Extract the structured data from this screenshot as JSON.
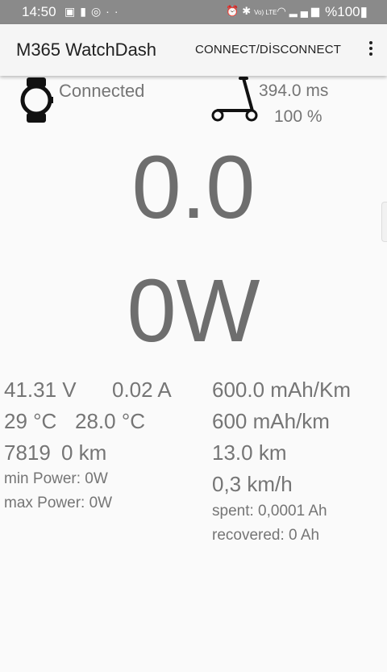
{
  "status_bar": {
    "time": "14:50",
    "battery": "%100",
    "left_icons": [
      "gallery-icon",
      "watch-app-icon",
      "whatsapp-icon",
      "more-dots-icon"
    ],
    "right_icons": [
      "alarm-icon",
      "bluetooth-icon",
      "volte-icon",
      "wifi-icon",
      "signal-icon",
      "battery-icon"
    ],
    "volte_label": "Vo) LTE"
  },
  "app_bar": {
    "title": "M365 WatchDash",
    "connect_label": "CONNECT/DİSCONNECT"
  },
  "watch": {
    "status": "Connected"
  },
  "scooter": {
    "latency": "394.0 ms",
    "battery": "100 %"
  },
  "dashboard": {
    "speed": "0.0",
    "power": "0W"
  },
  "stats_left": {
    "voltage": "41.31 V",
    "current": "0.02 A",
    "temp1": "29 °C",
    "temp2": "28.0 °C",
    "odometer_a": "7819",
    "odometer_b": "0 km",
    "min_power": "min Power: 0W",
    "max_power": "max Power: 0W"
  },
  "stats_right": {
    "consumption1": "600.0 mAh/Km",
    "consumption2": "600 mAh/km",
    "range": "13.0 km",
    "avg_speed": "0,3 km/h",
    "spent": "spent: 0,0001 Ah",
    "recovered": "recovered: 0 Ah"
  },
  "colors": {
    "status_bar": "#8a8a8a",
    "app_bar": "#f5f5f5",
    "text_gray": "#757575",
    "big_gray": "#6e6e6e",
    "background": "#fafafa"
  }
}
